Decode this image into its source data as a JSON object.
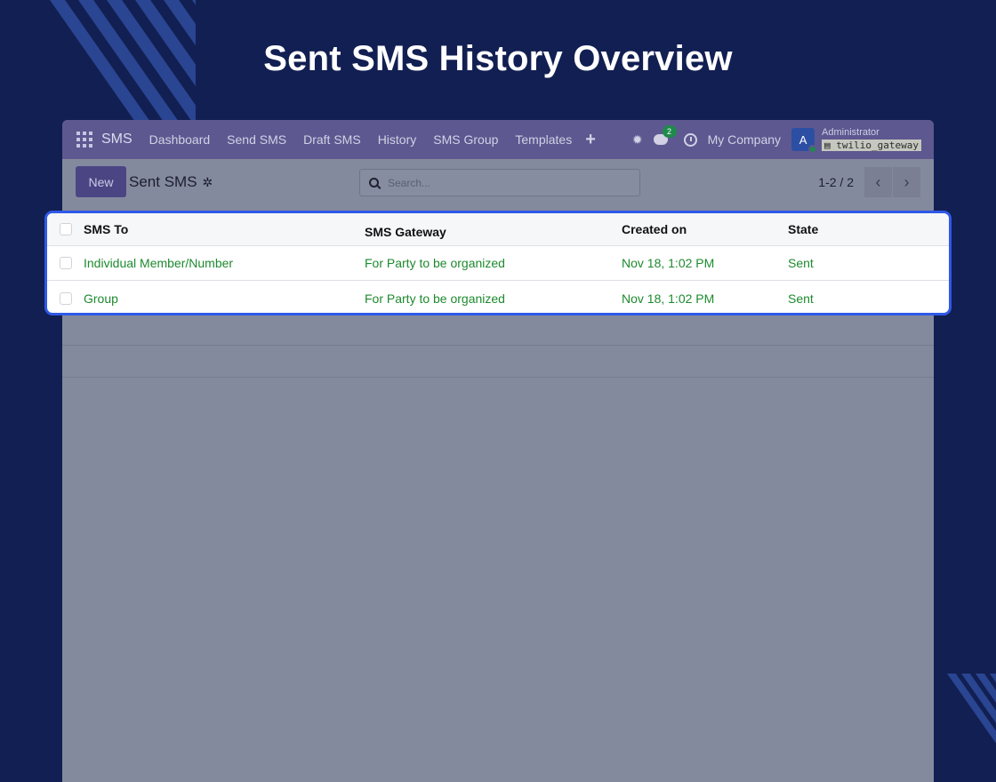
{
  "page": {
    "heading": "Sent SMS History Overview"
  },
  "navbar": {
    "app_name": "SMS",
    "items": [
      "Dashboard",
      "Send SMS",
      "Draft SMS",
      "History",
      "SMS Group",
      "Templates"
    ],
    "plus_label": "+",
    "message_count": "2",
    "company": "My Company",
    "avatar_letter": "A",
    "user_name": "Administrator",
    "db_name": "twilio_gateway"
  },
  "control_panel": {
    "new_label": "New",
    "breadcrumb": "Sent SMS",
    "search_placeholder": "Search...",
    "pager_value": "1-2 / 2",
    "prev_glyph": "‹",
    "next_glyph": "›"
  },
  "table": {
    "columns": [
      "SMS To",
      "SMS Gateway",
      "Created on",
      "State"
    ],
    "rows": [
      [
        "Individual Member/Number",
        "For Party to be organized",
        "Nov 18, 1:02 PM",
        "Sent"
      ],
      [
        "Group",
        "For Party to be organized",
        "Nov 18, 1:02 PM",
        "Sent"
      ]
    ]
  },
  "colors": {
    "background": "#121f52",
    "navbar": "#5d5890",
    "accent_border": "#2e59e8",
    "row_text": "#1d8a2e"
  }
}
